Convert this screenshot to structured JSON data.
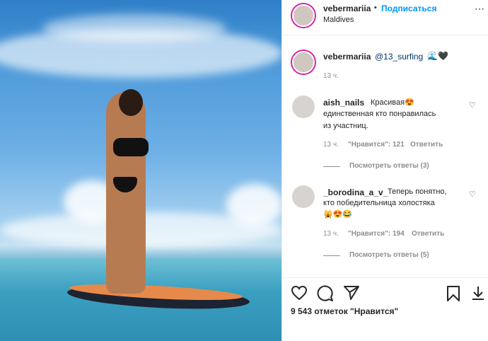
{
  "post": {
    "location": "Maldives",
    "username": "vebermariia",
    "follow_label": "Подписаться",
    "dot": "•"
  },
  "caption": {
    "username": "vebermariia",
    "mention": "@13_surfing",
    "emojis": "🌊🖤",
    "time": "13 ч."
  },
  "comments": [
    {
      "username": "aish_nails",
      "text_line1": "Красивая😍",
      "text_line2": "единственная кто понравилась",
      "text_line3": "из участниц.",
      "time": "13 ч.",
      "likes": "\"Нравится\": 121",
      "reply": "Ответить",
      "view_replies": "Посмотреть ответы (3)"
    },
    {
      "username": "_borodina_a_v_",
      "text_line1": "Теперь понятно,",
      "text_line2": "кто победительница холостяка",
      "text_line3": "🙀😍😂",
      "time": "13 ч.",
      "likes": "\"Нравится\": 194",
      "reply": "Ответить",
      "view_replies": "Посмотреть ответы (5)"
    }
  ],
  "footer": {
    "likes_count": "9 543 отметок \"Нравится\""
  },
  "icons": {
    "heart": "heart-icon",
    "comment": "comment-icon",
    "share": "share-icon",
    "bookmark": "bookmark-icon"
  },
  "colors": {
    "accent": "#0095f6",
    "text": "#262626",
    "muted": "#8e8e8e"
  }
}
